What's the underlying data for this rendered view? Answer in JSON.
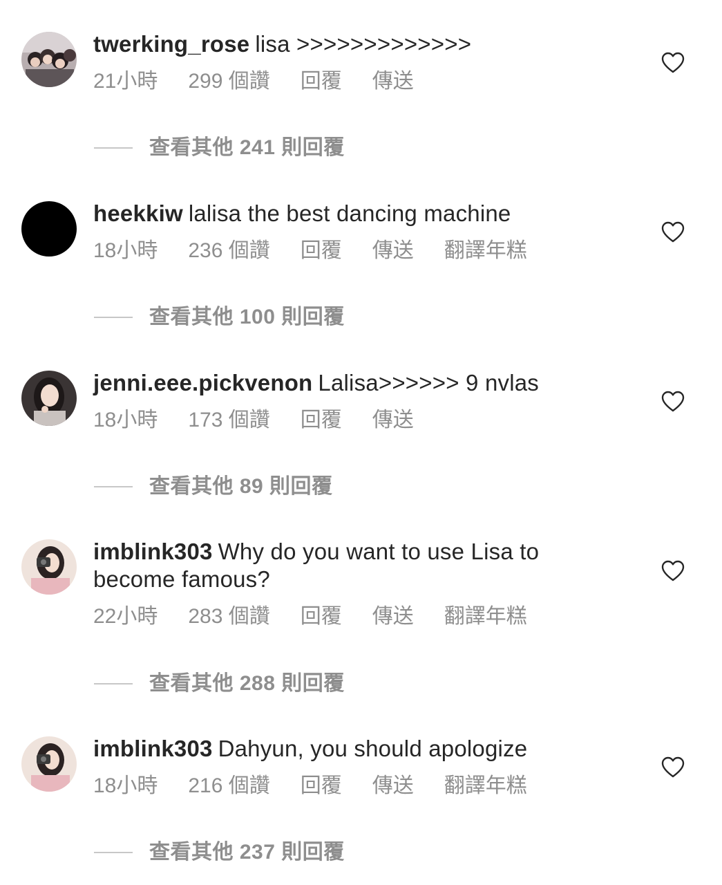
{
  "comments": [
    {
      "username": "twerking_rose",
      "text": "lisa >>>>>>>>>>>>>",
      "time": "21小時",
      "likes": "299 個讚",
      "reply": "回覆",
      "send": "傳送",
      "translate": "",
      "view_replies": "查看其他 241 則回覆",
      "avatar_icon": "group-photo-avatar"
    },
    {
      "username": "heekkiw",
      "text": "lalisa the best dancing machine",
      "time": "18小時",
      "likes": "236 個讚",
      "reply": "回覆",
      "send": "傳送",
      "translate": "翻譯年糕",
      "view_replies": "查看其他 100 則回覆",
      "avatar_icon": "black-circle-avatar"
    },
    {
      "username": "jenni.eee.pickvenon",
      "text": "Lalisa>>>>>> 9 nvlas",
      "time": "18小時",
      "likes": "173 個讚",
      "reply": "回覆",
      "send": "傳送",
      "translate": "",
      "view_replies": "查看其他 89 則回覆",
      "avatar_icon": "portrait-avatar"
    },
    {
      "username": "imblink303",
      "text": "Why do you want to use Lisa to become famous?",
      "time": "22小時",
      "likes": "283 個讚",
      "reply": "回覆",
      "send": "傳送",
      "translate": "翻譯年糕",
      "view_replies": "查看其他 288 則回覆",
      "avatar_icon": "camera-girl-avatar"
    },
    {
      "username": "imblink303",
      "text": "Dahyun, you should apologize",
      "time": "18小時",
      "likes": "216 個讚",
      "reply": "回覆",
      "send": "傳送",
      "translate": "翻譯年糕",
      "view_replies": "查看其他 237 則回覆",
      "avatar_icon": "camera-girl-avatar"
    }
  ],
  "colors": {
    "text": "#262626",
    "meta": "#8e8e8e",
    "divider": "#c7c7c7",
    "background": "#ffffff"
  },
  "icons": {
    "like": "heart-outline-icon"
  }
}
